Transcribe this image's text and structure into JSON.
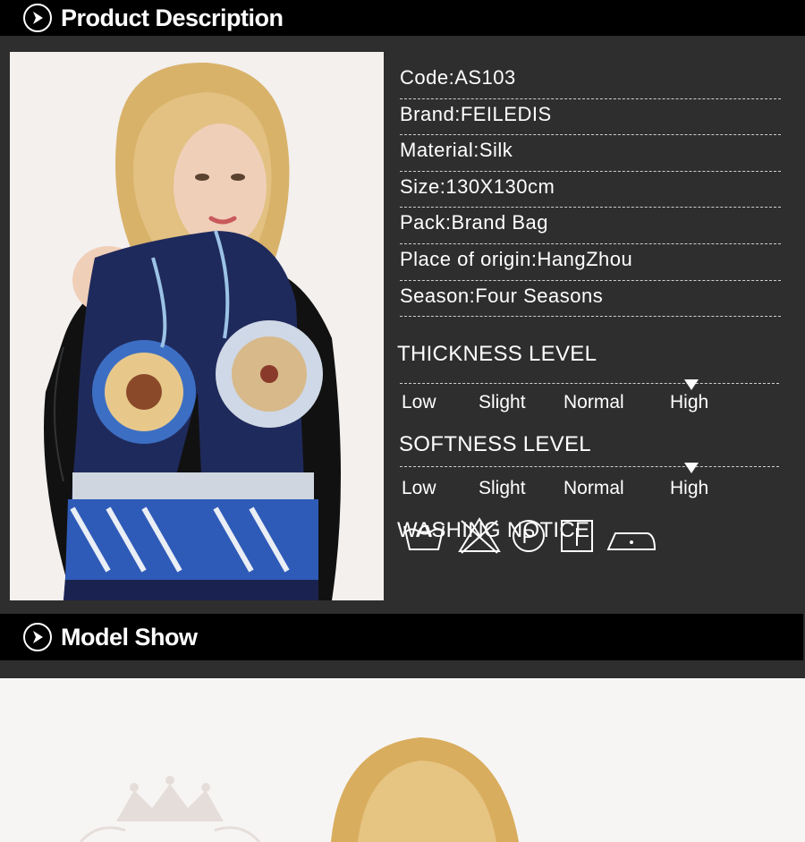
{
  "sections": {
    "description_title": "Product Description",
    "model_title": "Model Show"
  },
  "specs": [
    {
      "label": "Code:AS103"
    },
    {
      "label": "Brand:FEILEDIS"
    },
    {
      "label": "Material:Silk"
    },
    {
      "label": "Size:130X130cm"
    },
    {
      "label": "Pack:Brand Bag"
    },
    {
      "label": "Place of origin:HangZhou"
    },
    {
      "label": "Season:Four Seasons"
    }
  ],
  "thickness": {
    "title": "THICKNESS LEVEL",
    "options": [
      "Low",
      "Slight",
      "Normal",
      "High"
    ],
    "selected": "High"
  },
  "softness": {
    "title": "SOFTNESS LEVEL",
    "options": [
      "Low",
      "Slight",
      "Normal",
      "High"
    ],
    "selected": "High"
  },
  "washing": {
    "title": "WASHING NOTICE",
    "icons": [
      "hand-wash-icon",
      "no-bleach-icon",
      "dry-clean-p-icon",
      "line-dry-icon",
      "iron-low-icon"
    ]
  },
  "colors": {
    "header_bg": "#000000",
    "panel_bg": "#2e2e2e",
    "text": "#ffffff",
    "scarf_navy": "#1f2a5c",
    "scarf_blue": "#3c6fc4"
  }
}
